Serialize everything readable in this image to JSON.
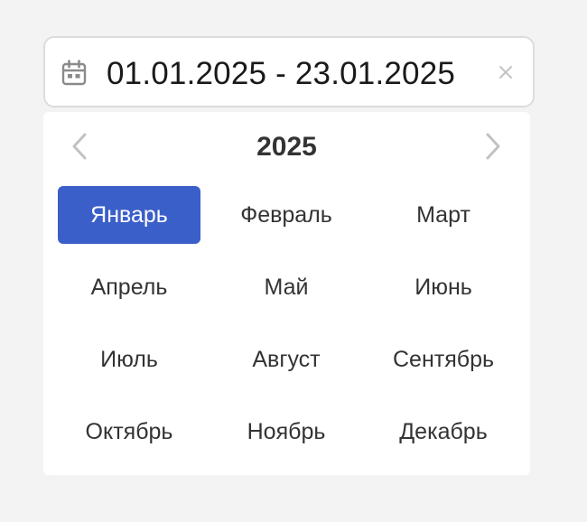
{
  "input": {
    "value": "01.01.2025 - 23.01.2025",
    "calendar_icon": "calendar-icon",
    "clear_icon": "close-icon"
  },
  "picker": {
    "year": "2025",
    "prev_icon": "chevron-left-icon",
    "next_icon": "chevron-right-icon",
    "months": [
      {
        "label": "Январь",
        "selected": true
      },
      {
        "label": "Февраль",
        "selected": false
      },
      {
        "label": "Март",
        "selected": false
      },
      {
        "label": "Апрель",
        "selected": false
      },
      {
        "label": "Май",
        "selected": false
      },
      {
        "label": "Июнь",
        "selected": false
      },
      {
        "label": "Июль",
        "selected": false
      },
      {
        "label": "Август",
        "selected": false
      },
      {
        "label": "Сентябрь",
        "selected": false
      },
      {
        "label": "Октябрь",
        "selected": false
      },
      {
        "label": "Ноябрь",
        "selected": false
      },
      {
        "label": "Декабрь",
        "selected": false
      }
    ]
  },
  "colors": {
    "accent": "#3b5fc9",
    "background": "#f3f3f3",
    "text": "#333333"
  }
}
